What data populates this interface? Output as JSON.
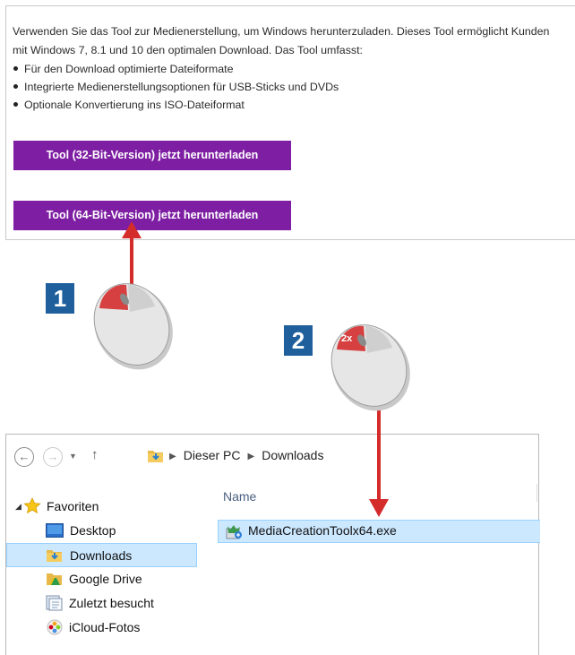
{
  "web": {
    "intro_line1": "Verwenden Sie das Tool zur Medienerstellung, um Windows herunterzuladen. Dieses Tool ermöglicht Kunden",
    "intro_line2": "mit Windows 7, 8.1 und 10 den optimalen Download. Das Tool umfasst:",
    "features": [
      "Für den Download optimierte Dateiformate",
      "Integrierte Medienerstellungsoptionen für USB-Sticks und DVDs",
      "Optionale Konvertierung ins ISO-Dateiformat"
    ],
    "button_32": "Tool (32-Bit-Version) jetzt herunterladen",
    "button_64": "Tool (64-Bit-Version) jetzt herunterladen"
  },
  "steps": {
    "step1": "1",
    "step2": "2",
    "double_click_label": "2x"
  },
  "explorer": {
    "breadcrumb": [
      "Dieser PC",
      "Downloads"
    ],
    "column_name": "Name",
    "tree": [
      {
        "label": "Favoriten",
        "icon": "star-icon"
      },
      {
        "label": "Desktop",
        "icon": "desktop-icon"
      },
      {
        "label": "Downloads",
        "icon": "downloads-folder-icon",
        "selected": true
      },
      {
        "label": "Google Drive",
        "icon": "google-drive-icon"
      },
      {
        "label": "Zuletzt besucht",
        "icon": "recent-places-icon"
      },
      {
        "label": "iCloud-Fotos",
        "icon": "icloud-photos-icon"
      }
    ],
    "file": {
      "name": "MediaCreationToolx64.exe",
      "icon": "media-creation-tool-icon"
    }
  },
  "colors": {
    "button_purple": "#7e1fa3",
    "badge_blue": "#1f5f9c",
    "arrow_red": "#d42b2b",
    "selection_blue": "#cce8ff"
  }
}
